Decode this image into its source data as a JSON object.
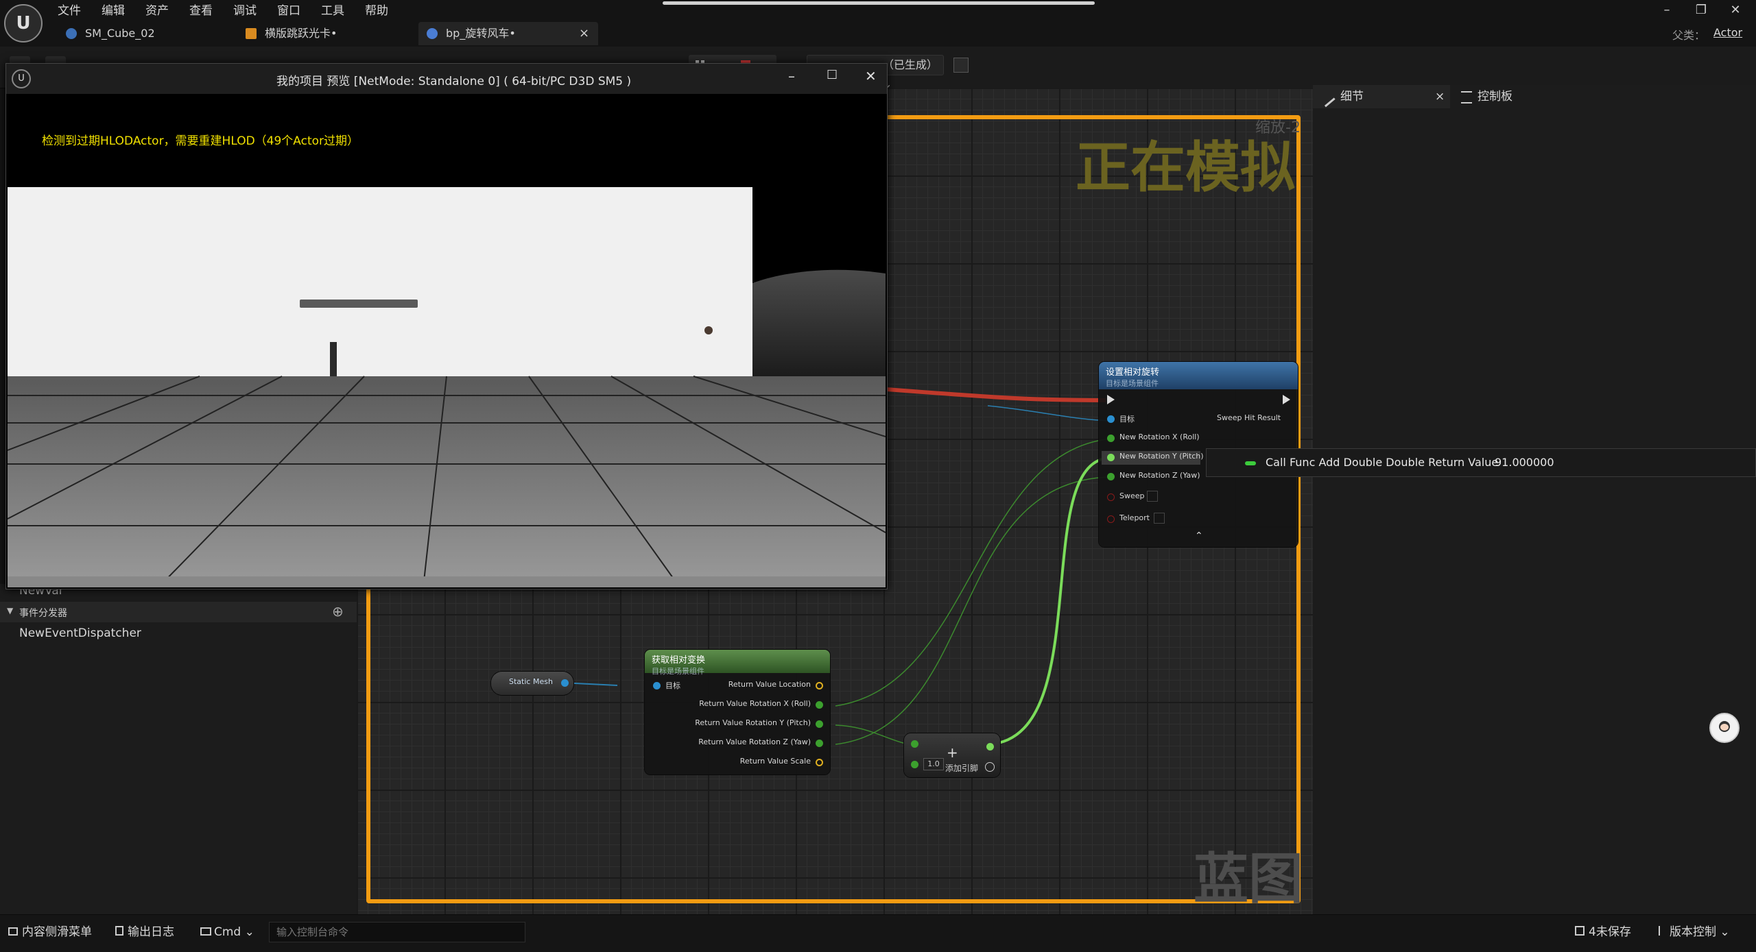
{
  "menu": [
    "文件",
    "编辑",
    "资产",
    "查看",
    "调试",
    "窗口",
    "工具",
    "帮助"
  ],
  "tabs": [
    {
      "label": "SM_Cube_02",
      "icon": "static-mesh-icon"
    },
    {
      "label": "横版跳跃光卡•",
      "icon": "level-icon"
    },
    {
      "label": "bp_旋转风车•",
      "icon": "blueprint-icon",
      "close": "×"
    }
  ],
  "window_controls": {
    "minimize": "–",
    "restore": "❐",
    "close": "✕"
  },
  "parent": {
    "label": "父类：",
    "value": "Actor"
  },
  "toolbar": {
    "debug_filter": "（已生成）"
  },
  "details": {
    "tab_details": "细节",
    "tab_close": "×",
    "tab_console": "控制板"
  },
  "preview": {
    "title": "我的项目 预览 [NetMode: Standalone 0]  ( 64-bit/PC D3D SM5 )",
    "warning": "检测到过期HLODActor，需要重建HLOD（49个Actor过期）",
    "controls": {
      "minimize": "–",
      "maximize": "☐",
      "close": "✕"
    }
  },
  "left_panel": {
    "newvar_fragment": "NewVar",
    "section": "事件分发器",
    "add": "⊕",
    "dispatcher": "NewEventDispatcher"
  },
  "graph": {
    "simulating": "正在模拟",
    "zoom": "缩放-2",
    "watermark": "蓝图"
  },
  "nodes": {
    "set_rot": {
      "title": "设置相对旋转",
      "subtitle": "目标是场景组件",
      "pins_in": [
        "目标",
        "New Rotation X (Roll)",
        "New Rotation Y (Pitch)",
        "New Rotation Z (Yaw)",
        "Sweep",
        "Teleport"
      ],
      "pin_out": "Sweep Hit Result",
      "expand": "⌃"
    },
    "get_rel": {
      "title": "获取相对变换",
      "subtitle": "目标是场景组件",
      "pin_in": "目标",
      "pins_out": [
        "Return Value Location",
        "Return Value Rotation X (Roll)",
        "Return Value Rotation Y (Pitch)",
        "Return Value Rotation Z (Yaw)",
        "Return Value Scale"
      ]
    },
    "static_mesh": "Static Mesh",
    "add": {
      "symbol": "+",
      "b_value": "1.0",
      "add_pin": "添加引脚"
    }
  },
  "tooltip": {
    "label": "Call Func Add Double Double Return Value",
    "value": "91.000000"
  },
  "statusbar": {
    "content_drawer": "内容侧滑菜单",
    "output_log": "输出日志",
    "cmd": "Cmd",
    "cmd_placeholder": "输入控制台命令",
    "unsaved": "4未保存",
    "source_control": "版本控制"
  },
  "colors": {
    "sim_border": "#f39c12",
    "exec_wire": "#c0392b",
    "float_wire": "#7bdc5a",
    "func_node_blue": "#2c5d8a",
    "func_node_green": "#3e6b34"
  }
}
